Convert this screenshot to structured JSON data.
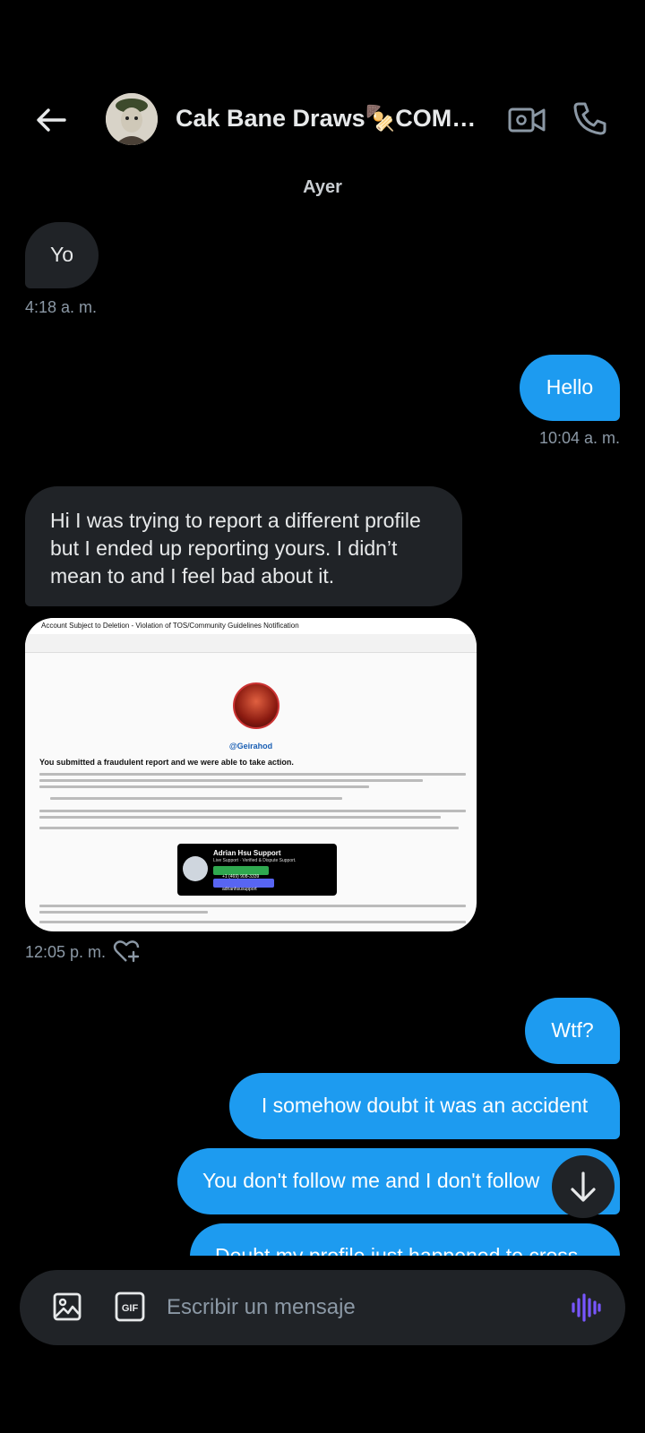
{
  "header": {
    "title": "Cak Bane Draws🍢COMM..."
  },
  "day_label": "Ayer",
  "messages": {
    "m1": {
      "text": "Yo",
      "time": "4:18 a. m."
    },
    "m2": {
      "text": "Hello",
      "time": "10:04 a. m."
    },
    "m3": {
      "text": "Hi I was trying to report a different profile but I ended up reporting yours. I didn’t mean to and I feel bad about it."
    },
    "m3_image_time": "12:05 p. m.",
    "m4": {
      "text": "Wtf?"
    },
    "m5": {
      "text": "I somehow doubt it was an accident"
    },
    "m6": {
      "text": "You don't follow me and I don't follow"
    },
    "m7": {
      "text": "Doubt my profile just happened to cross"
    }
  },
  "attachment": {
    "header_text": "Account Subject to Deletion - Violation of TOS/Community Guidelines Notification",
    "handle": "@Geirahod",
    "heading": "You submitted a fraudulent report and we were able to take action.",
    "card_name": "Adrian Hsu Support",
    "card_sub": "Live Support · Verified & Dispute Support.",
    "card_phone": "+1 (469) 908-3339",
    "card_discord": "adrianhsusupport"
  },
  "composer": {
    "placeholder": "Escribir un mensaje"
  },
  "colors": {
    "accent": "#1d9bf0",
    "incoming": "#202327",
    "background": "#000000",
    "voice": "#7856ff"
  }
}
